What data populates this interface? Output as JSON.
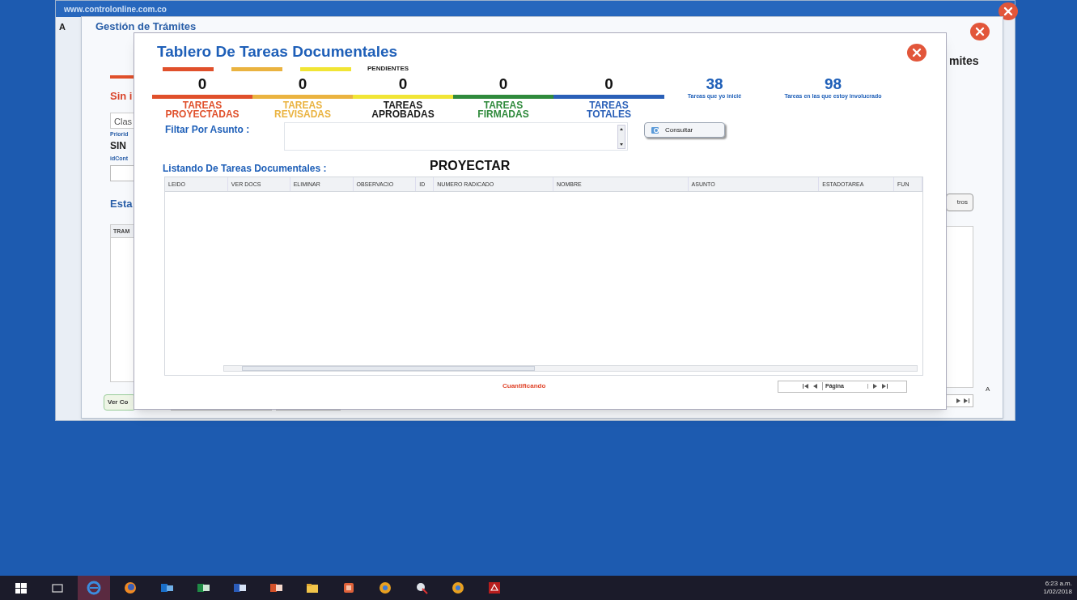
{
  "back_window": {
    "url": "www.controlonline.com.co",
    "tab": "A"
  },
  "main_window": {
    "title": "Gestión de Trámites",
    "title_end": "mites",
    "section": "Sin i",
    "class_field": "Clas",
    "priority_label": "Priorid",
    "priority_value": "SIN",
    "id_label": "idCont",
    "state_title": "Esta",
    "table_header": "TRAM",
    "view_button": "Ver Co",
    "filter_button": "tros",
    "side_text": "A"
  },
  "dialog": {
    "title": "Tablero De Tareas Documentales",
    "legend": {
      "bars": [
        {
          "color": "#e0502b"
        },
        {
          "color": "#eab340"
        },
        {
          "color": "#f1e535"
        }
      ],
      "label": "PENDIENTES"
    },
    "stats": [
      {
        "count": "0",
        "label": "TAREAS PROYECTADAS",
        "color": "#e0502b"
      },
      {
        "count": "0",
        "label": "TAREAS REVISADAS",
        "color": "#eab340"
      },
      {
        "count": "0",
        "label": "TAREAS APROBADAS",
        "color": "#f1e535"
      },
      {
        "count": "0",
        "label": "TAREAS FIRMADAS",
        "color": "#2f8a3c"
      },
      {
        "count": "0",
        "label": "TAREAS TOTALES",
        "color": "#2a60b8"
      }
    ],
    "summaries": [
      {
        "count": "38",
        "label": "Tareas que yo inicié"
      },
      {
        "count": "98",
        "label": "Tareas en las que estoy involucrado"
      }
    ],
    "filter": {
      "label": "Filtar Por Asunto :",
      "button": "Consultar"
    },
    "list_title": "Listando De Tareas Documentales :",
    "mode": "PROYECTAR",
    "table": {
      "columns": [
        "LEIDO",
        "VER DOCS",
        "ELIMINAR",
        "OBSERVACIO",
        "ID",
        "NUMERO RADICADO",
        "NOMBRE",
        "ASUNTO",
        "ESTADOTAREA",
        "FUN"
      ]
    },
    "status": "Cuantificando",
    "pager": {
      "label": "Página"
    }
  },
  "taskbar": {
    "items": [
      {
        "kind": "start",
        "selected": false
      },
      {
        "kind": "taskview",
        "selected": false
      },
      {
        "kind": "edge",
        "selected": true
      },
      {
        "kind": "firefox",
        "selected": false
      },
      {
        "kind": "mail",
        "selected": false
      },
      {
        "kind": "sheet",
        "selected": false
      },
      {
        "kind": "doc",
        "selected": false
      },
      {
        "kind": "slides",
        "selected": false
      },
      {
        "kind": "folder",
        "selected": false
      },
      {
        "kind": "app",
        "selected": false
      },
      {
        "kind": "chrome",
        "selected": false
      },
      {
        "kind": "tool",
        "selected": false
      },
      {
        "kind": "chrome",
        "selected": false
      },
      {
        "kind": "pdf",
        "selected": false
      }
    ],
    "time": "6:23 a.m.",
    "date": "1/02/2018"
  }
}
